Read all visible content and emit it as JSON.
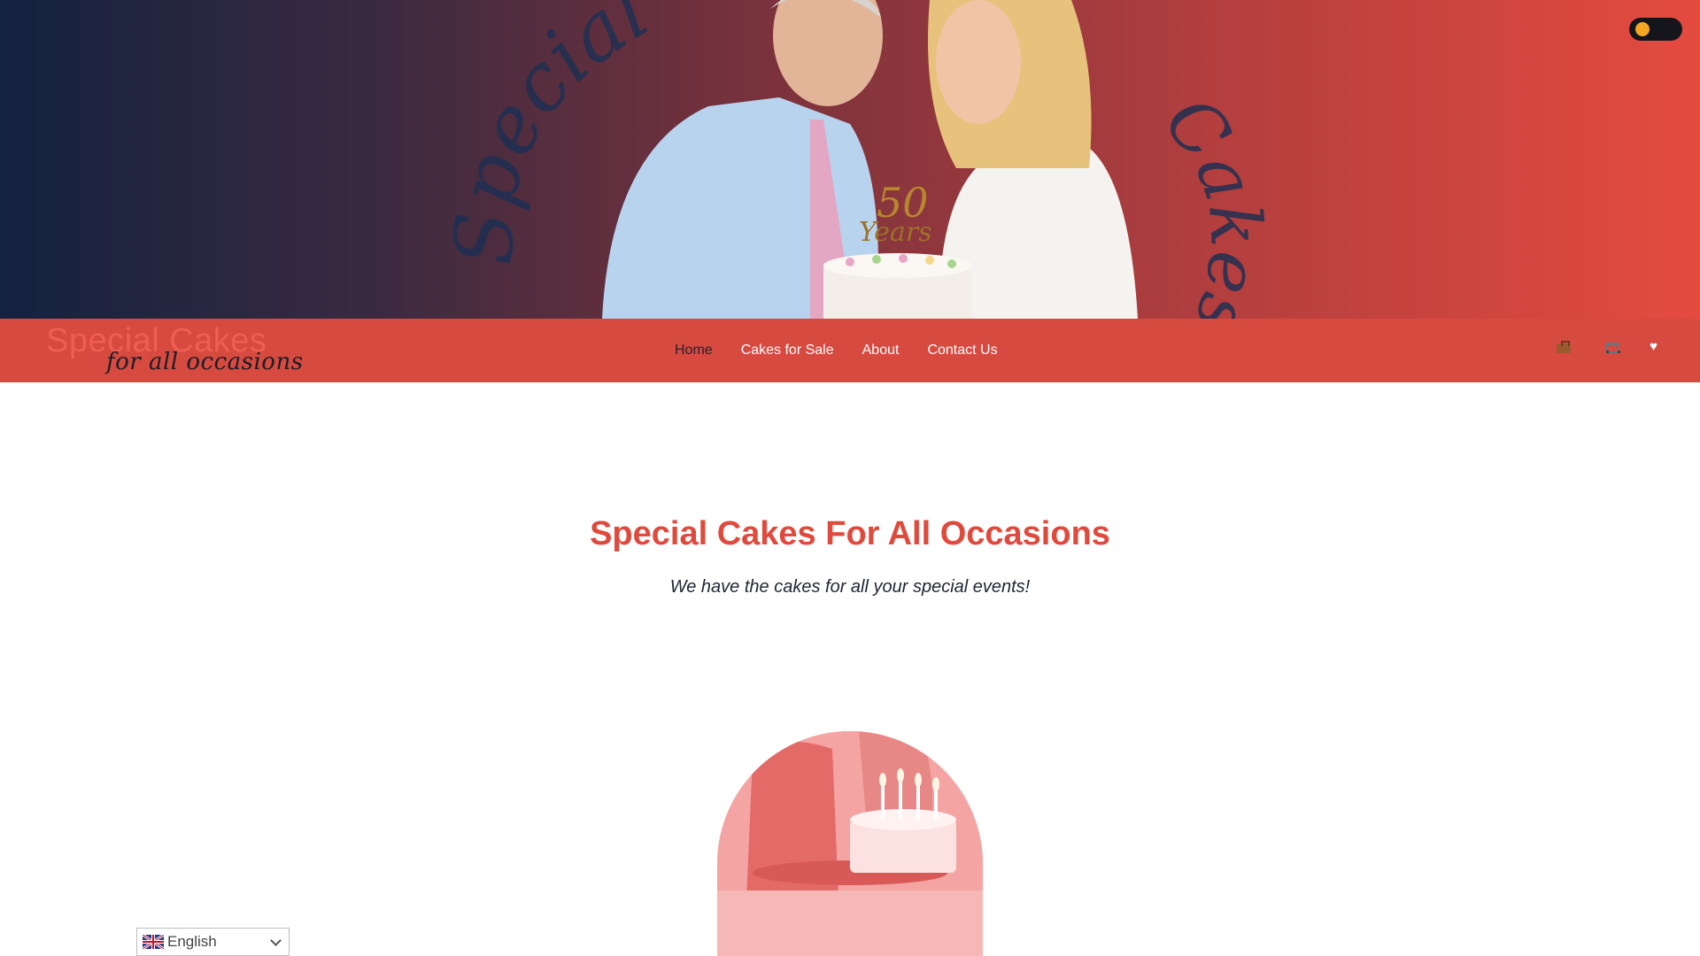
{
  "theme": {
    "accent": "#e04a3d",
    "nav_bg": "#d64a40",
    "hero_gradient": [
      "#13223f",
      "#e54b3f"
    ]
  },
  "hero": {
    "decor_left_text": "Special",
    "decor_right_text": "Cakes",
    "topper_number": "50",
    "topper_text": "Years",
    "theme_toggle": "dark-mode-toggle"
  },
  "nav": {
    "logo_main": "Special Cakes",
    "logo_sub": "for all occasions",
    "items": [
      {
        "label": "Home",
        "active": true
      },
      {
        "label": "Cakes for Sale",
        "active": false
      },
      {
        "label": "About",
        "active": false
      },
      {
        "label": "Contact Us",
        "active": false
      }
    ],
    "icons": [
      "briefcase-icon",
      "cart-icon",
      "heart-icon"
    ]
  },
  "main": {
    "headline": "Special Cakes For All Occasions",
    "tagline": "We have the cakes for all your special events!"
  },
  "language": {
    "selected": "English",
    "flag": "uk-flag-icon"
  }
}
